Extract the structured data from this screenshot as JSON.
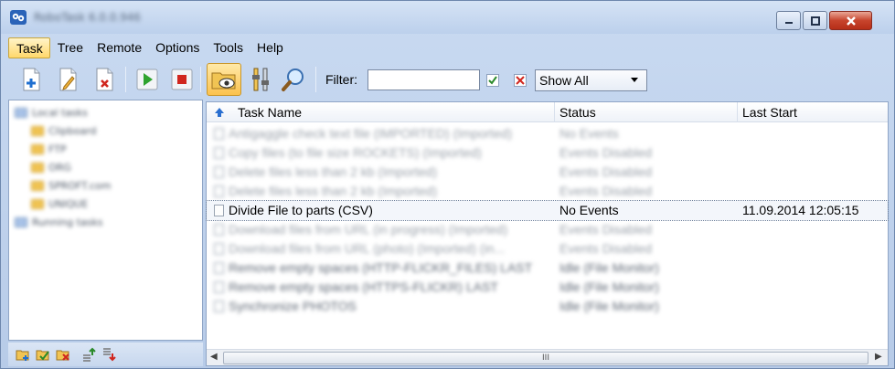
{
  "window": {
    "title": "RoboTask 6.0.0.946"
  },
  "menu": [
    {
      "label": "Task",
      "active": true
    },
    {
      "label": "Tree"
    },
    {
      "label": "Remote"
    },
    {
      "label": "Options"
    },
    {
      "label": "Tools"
    },
    {
      "label": "Help"
    }
  ],
  "toolbar": {
    "filter_label": "Filter:",
    "filter_value": "",
    "show_option": "Show All",
    "buttons": [
      "new-task-icon",
      "edit-task-icon",
      "delete-task-icon",
      "run-icon",
      "stop-icon",
      "folder-view-icon",
      "tools-icon",
      "search-icon"
    ]
  },
  "tree": {
    "root": "Local tasks",
    "groups": [
      "Clipboard",
      "FTP",
      "ORG",
      "SPROFT.com",
      "UNIQUE"
    ],
    "running": "Running tasks"
  },
  "list": {
    "columns": [
      "Task Name",
      "Status",
      "Last Start"
    ],
    "rows": [
      {
        "name": "Antigaggle check text file (IMPORTED) (Imported)",
        "status": "No Events",
        "last": "",
        "blur": true
      },
      {
        "name": "Copy files (to file size ROCKETS) (Imported)",
        "status": "Events Disabled",
        "last": "",
        "blur": true
      },
      {
        "name": "Delete files less than 2 kb (Imported)",
        "status": "Events Disabled",
        "last": "",
        "blur": true
      },
      {
        "name": "Delete files less than 2 kb (Imported)",
        "status": "Events Disabled",
        "last": "",
        "blur": true
      },
      {
        "name": "Divide File to parts (CSV)",
        "status": "No Events",
        "last": "11.09.2014 12:05:15",
        "blur": false,
        "selected": true
      },
      {
        "name": "Download files from URL (in progress) (Imported)",
        "status": "Events Disabled",
        "last": "",
        "blur": true
      },
      {
        "name": "Download files from URL (photo) (Imported) (in...",
        "status": "Events Disabled",
        "last": "",
        "blur": true
      },
      {
        "name": "Remove empty spaces (HTTP-FLICKR_FILES) LAST",
        "status": "Idle (File Monitor)",
        "last": "",
        "blur": true,
        "dark": true
      },
      {
        "name": "Remove empty spaces (HTTPS-FLICKR) LAST",
        "status": "Idle (File Monitor)",
        "last": "",
        "blur": true,
        "dark": true
      },
      {
        "name": "Synchronize PHOTOS",
        "status": "Idle (File Monitor)",
        "last": "",
        "blur": true,
        "dark": true
      }
    ]
  },
  "scrollbar": {
    "grip": "III"
  }
}
